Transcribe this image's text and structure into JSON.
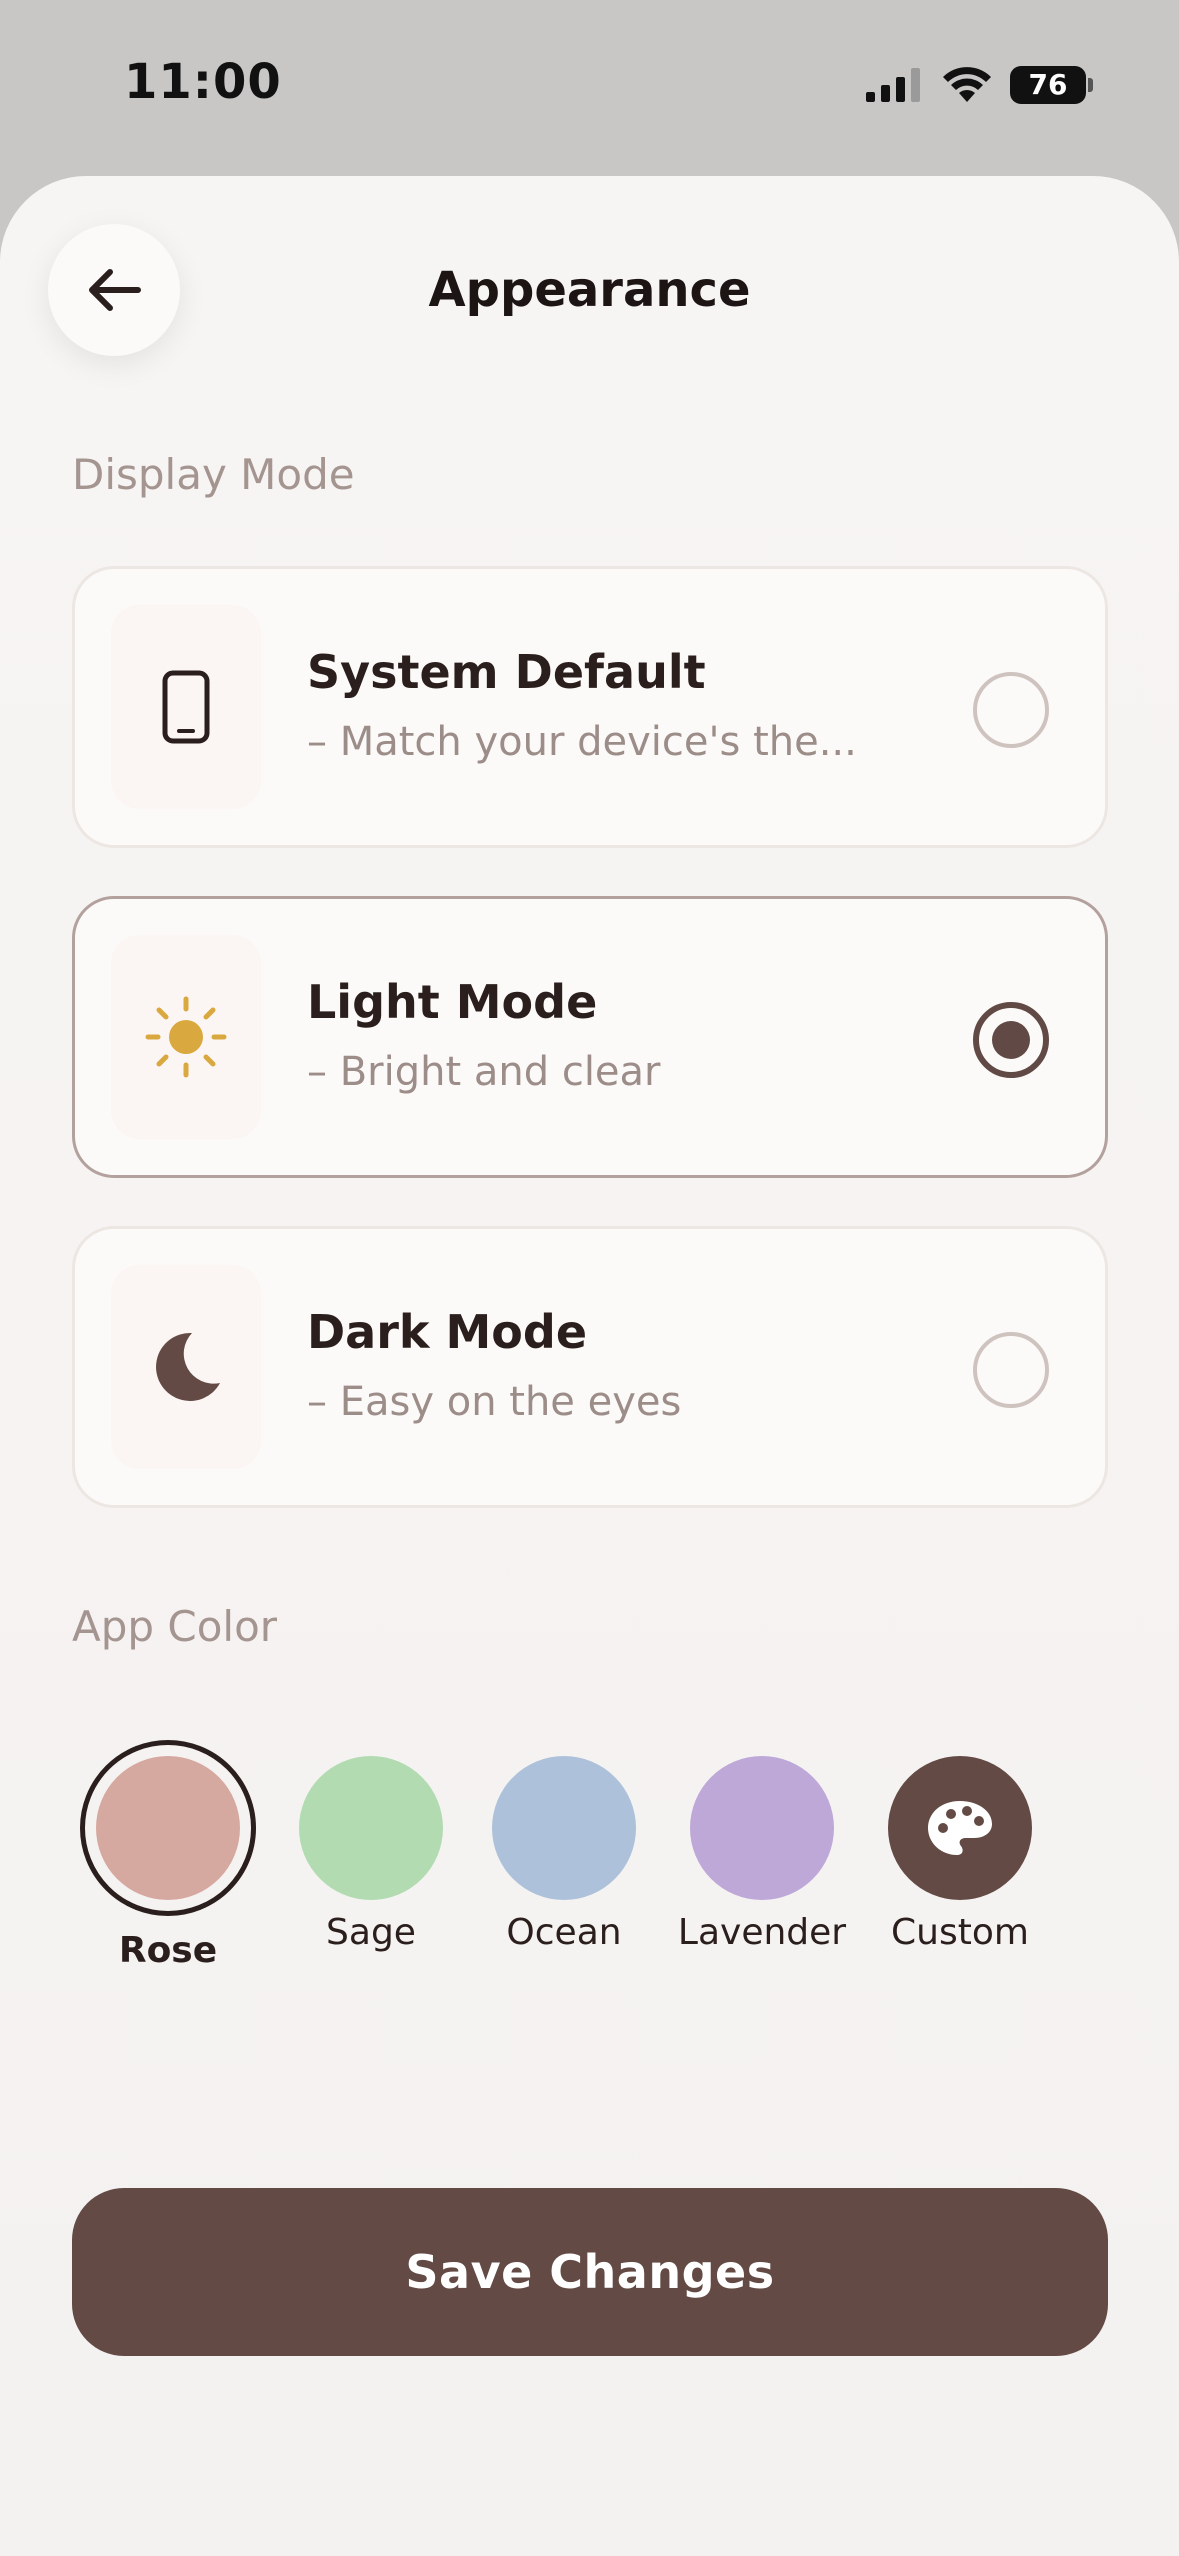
{
  "status": {
    "time": "11:00",
    "battery": "76"
  },
  "header": {
    "title": "Appearance"
  },
  "display_mode": {
    "label": "Display Mode",
    "options": [
      {
        "title": "System Default",
        "subtitle": "– Match your device's the...",
        "selected": false,
        "icon": "phone-icon"
      },
      {
        "title": "Light Mode",
        "subtitle": "– Bright and clear",
        "selected": true,
        "icon": "sun-icon"
      },
      {
        "title": "Dark Mode",
        "subtitle": "– Easy on the eyes",
        "selected": false,
        "icon": "moon-icon"
      }
    ]
  },
  "app_color": {
    "label": "App Color",
    "swatches": [
      {
        "label": "Rose",
        "color": "#d6a9a0",
        "selected": true
      },
      {
        "label": "Sage",
        "color": "#b2dbb2",
        "selected": false
      },
      {
        "label": "Ocean",
        "color": "#adc2da",
        "selected": false
      },
      {
        "label": "Lavender",
        "color": "#bda8d8",
        "selected": false
      },
      {
        "label": "Custom",
        "color": "#634a44",
        "selected": false,
        "icon": "palette-icon"
      }
    ]
  },
  "footer": {
    "save_label": "Save Changes"
  }
}
